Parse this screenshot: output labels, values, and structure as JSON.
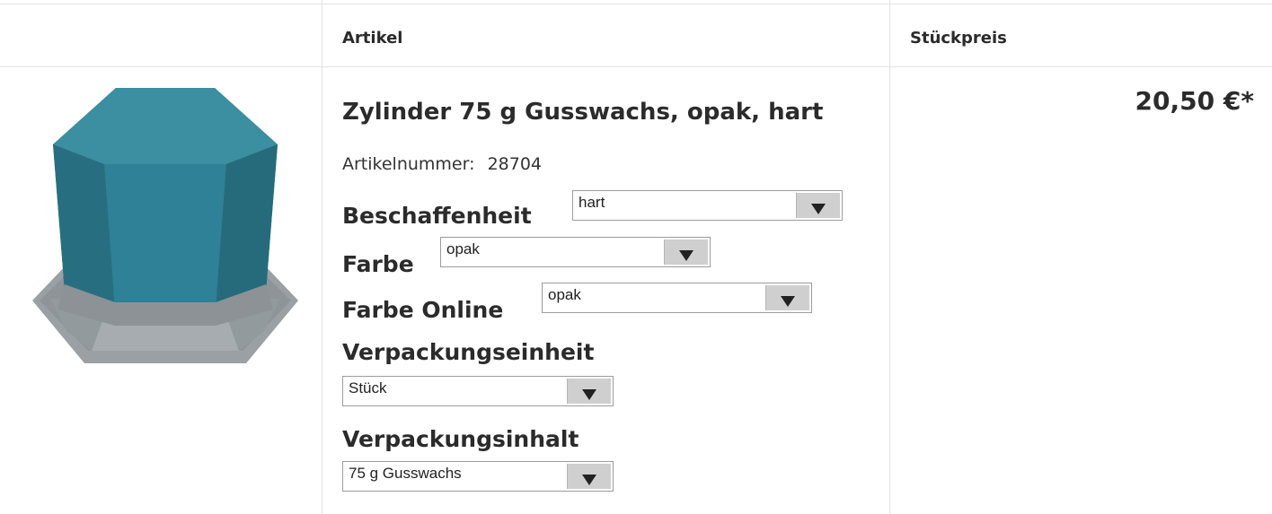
{
  "table": {
    "headers": {
      "article": "Artikel",
      "unit_price": "Stückpreis"
    }
  },
  "product": {
    "title": "Zylinder 75 g Gusswachs, opak, hart",
    "article_number_label": "Artikelnummer:",
    "article_number": "28704",
    "price": "20,50 €*",
    "image_icon": "product-image-wax-block",
    "colors": {
      "wax": "#2b7b8e",
      "base": "#9aa0a3"
    }
  },
  "options": {
    "beschaffenheit": {
      "label": "Beschaffenheit",
      "value": "hart"
    },
    "farbe": {
      "label": "Farbe",
      "value": "opak"
    },
    "farbe_online": {
      "label": "Farbe Online",
      "value": "opak"
    },
    "verpackungseinheit": {
      "label": "Verpackungseinheit",
      "value": "Stück"
    },
    "verpackungsinhalt": {
      "label": "Verpackungsinhalt",
      "value": "75 g Gusswachs"
    }
  }
}
